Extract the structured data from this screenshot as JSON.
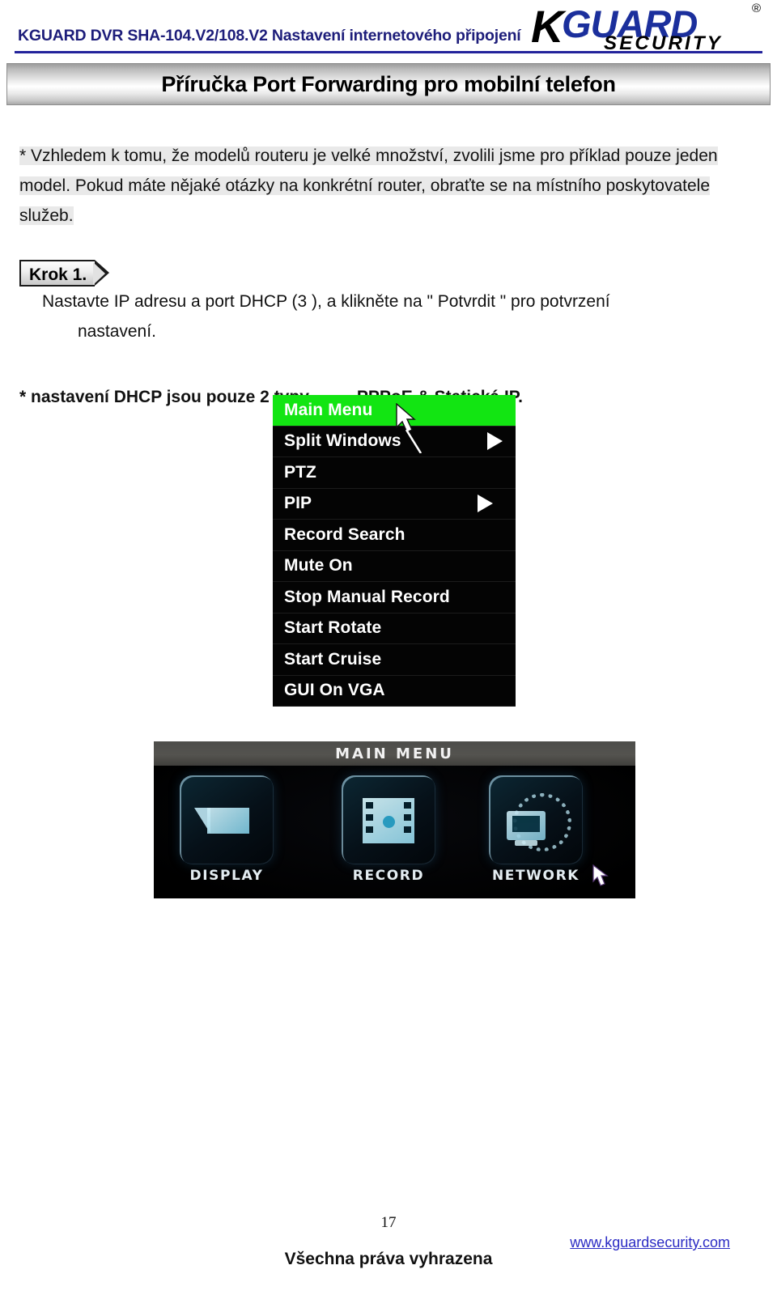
{
  "header": {
    "product_line": "KGUARD DVR SHA-104.V2/108.V2  Nastavení internetového připojení",
    "logo": {
      "k": "K",
      "guard": "GUARD",
      "security": "SECURITY",
      "registered": "®"
    }
  },
  "title_banner": {
    "text": "Příručka Port Forwarding pro mobilní telefon"
  },
  "body": {
    "note_paragraph": "* Vzhledem k tomu, že modelů routeru je velké množství, zvolili jsme pro příklad pouze jeden model. Pokud máte nějaké otázky na konkrétní router, obraťte se na místního poskytovatele služeb.",
    "step": {
      "badge": "Krok 1.",
      "line1": "Nastavte IP adresu a port DHCP (3 ), a klikněte na \" Potvrdit \" pro potvrzení",
      "line2": "nastavení."
    },
    "dhcp_note_prefix": "* nastavení DHCP jsou pouze 2 typy",
    "dhcp_note_arrow": "→",
    "dhcp_note_suffix": "PPPoE & Statická IP."
  },
  "osd_menu": {
    "highlight_color": "#12e512",
    "items": [
      {
        "label": "Main Menu",
        "highlighted": true,
        "arrow": false
      },
      {
        "label": "Split Windows",
        "highlighted": false,
        "arrow": true
      },
      {
        "label": "PTZ",
        "highlighted": false,
        "arrow": false
      },
      {
        "label": "PIP",
        "highlighted": false,
        "arrow": true
      },
      {
        "label": "Record Search",
        "highlighted": false,
        "arrow": false
      },
      {
        "label": "Mute On",
        "highlighted": false,
        "arrow": false
      },
      {
        "label": "Stop Manual Record",
        "highlighted": false,
        "arrow": false
      },
      {
        "label": "Start Rotate",
        "highlighted": false,
        "arrow": false
      },
      {
        "label": "Start Cruise",
        "highlighted": false,
        "arrow": false
      },
      {
        "label": "GUI On VGA",
        "highlighted": false,
        "arrow": false
      }
    ]
  },
  "dvr_screen": {
    "title": "MAIN MENU",
    "items": [
      {
        "label": "DISPLAY",
        "icon": "camera-icon"
      },
      {
        "label": "RECORD",
        "icon": "film-strip-icon"
      },
      {
        "label": "NETWORK",
        "icon": "network-globe-icon"
      }
    ]
  },
  "footer": {
    "page_number": "17",
    "rights": "Všechna práva vyhrazena",
    "website": "www.kguardsecurity.com"
  }
}
